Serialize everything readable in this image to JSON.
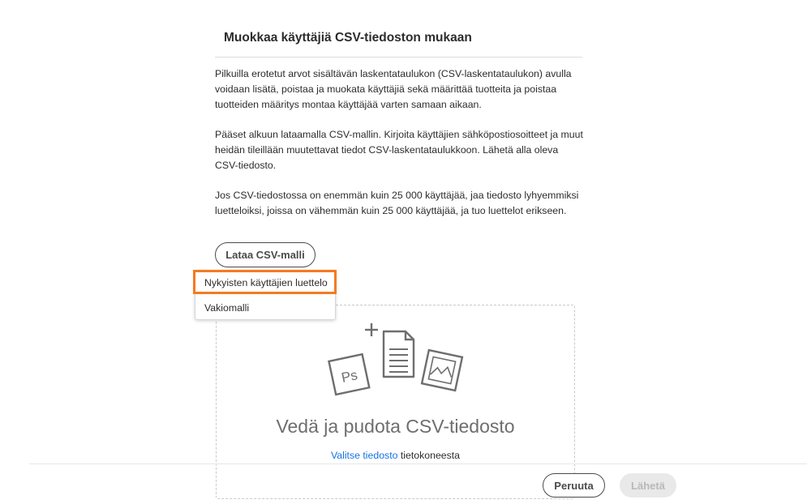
{
  "dialog": {
    "title": "Muokkaa käyttäjiä CSV-tiedoston mukaan",
    "paragraphs": [
      "Pilkuilla erotetut arvot sisältävän laskentataulukon (CSV-laskentataulukon) avulla voidaan lisätä, poistaa ja muokata käyttäjiä sekä määrittää tuotteita ja poistaa tuotteiden määritys montaa käyttäjää varten samaan aikaan.",
      "Pääset alkuun lataamalla CSV-mallin. Kirjoita käyttäjien sähköpostiosoitteet ja muut heidän tileillään muutettavat tiedot CSV-laskentataulukkoon. Lähetä alla oleva CSV-tiedosto.",
      "Jos CSV-tiedostossa on enemmän kuin 25 000 käyttäjää, jaa tiedosto lyhyemmiksi luetteloiksi, joissa on vähemmän kuin 25 000 käyttäjää, ja tuo luettelot erikseen."
    ],
    "download_button": "Lataa CSV-malli",
    "menu": {
      "items": [
        "Nykyisten käyttäjien luettelo",
        "Vakiomalli"
      ],
      "highlighted_index": 0,
      "highlight_color": "#f47b20"
    },
    "dropzone": {
      "title": "Vedä ja pudota CSV-tiedosto",
      "link": "Valitse tiedosto",
      "suffix": " tietokoneesta",
      "icons": [
        "photoshop-file-icon",
        "add-document-icon",
        "image-file-icon"
      ]
    },
    "footer": {
      "cancel": "Peruuta",
      "send": "Lähetä",
      "send_disabled": true
    }
  },
  "colors": {
    "text": "#2c2c2c",
    "link": "#1473e6",
    "icon": "#6e6e6e",
    "disabled_bg": "#e9e9e9",
    "disabled_text": "#b8b8b8"
  }
}
